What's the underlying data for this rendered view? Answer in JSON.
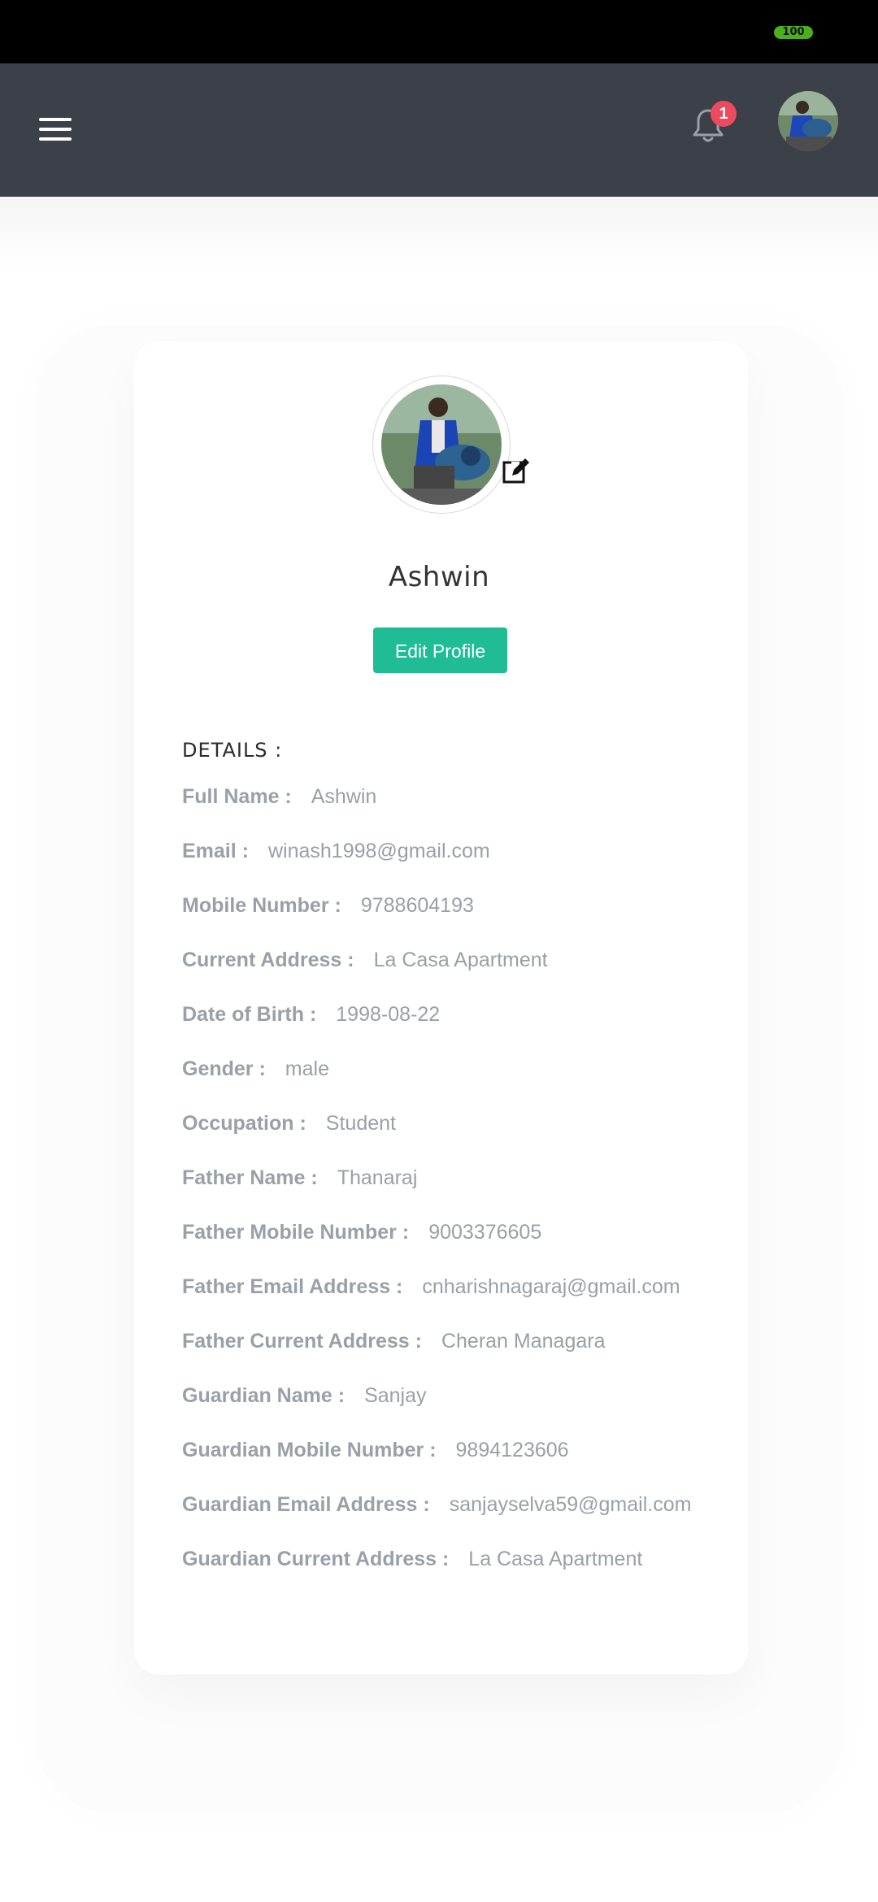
{
  "status_bar": {
    "battery_level": "100",
    "battery_color": "#4caf1f"
  },
  "header": {
    "background": "#3b4049",
    "notification_count": "1",
    "badge_color": "#ee4a5e"
  },
  "profile": {
    "name": "Ashwin",
    "edit_button_label": "Edit Profile",
    "accent_color": "#1fbc96"
  },
  "details": {
    "heading": "DETAILS :",
    "rows": [
      {
        "label": "Full Name :",
        "value": "Ashwin"
      },
      {
        "label": "Email :",
        "value": "winash1998@gmail.com"
      },
      {
        "label": "Mobile Number :",
        "value": "9788604193"
      },
      {
        "label": "Current Address :",
        "value": "La Casa Apartment"
      },
      {
        "label": "Date of Birth :",
        "value": "1998-08-22"
      },
      {
        "label": "Gender :",
        "value": "male"
      },
      {
        "label": "Occupation :",
        "value": "Student"
      },
      {
        "label": "Father Name :",
        "value": "Thanaraj"
      },
      {
        "label": "Father Mobile Number :",
        "value": "9003376605"
      },
      {
        "label": "Father Email Address :",
        "value": "cnharishnagaraj@gmail.com"
      },
      {
        "label": "Father Current Address :",
        "value": "Cheran Managara"
      },
      {
        "label": "Guardian Name :",
        "value": "Sanjay"
      },
      {
        "label": "Guardian Mobile Number :",
        "value": "9894123606"
      },
      {
        "label": "Guardian Email Address :",
        "value": "sanjayselva59@gmail.com"
      },
      {
        "label": "Guardian Current Address :",
        "value": "La Casa Apartment"
      }
    ]
  }
}
